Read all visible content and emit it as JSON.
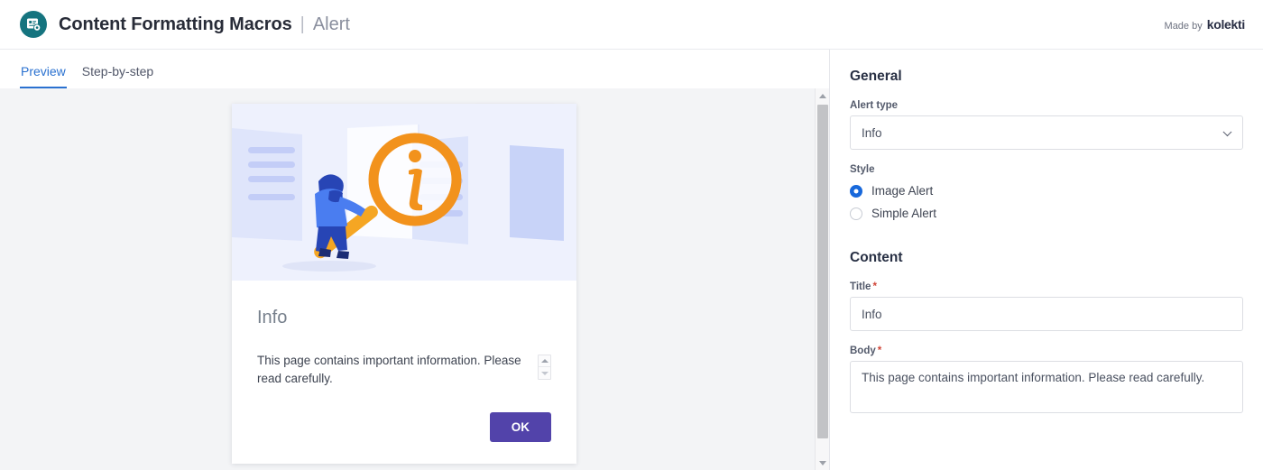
{
  "header": {
    "logo_icon": "document-gear-icon",
    "title": "Content Formatting Macros",
    "separator": "|",
    "subtitle": "Alert",
    "made_by_text": "Made by",
    "made_by_brand": "kolekti",
    "brand_color": "#15747f"
  },
  "tabs": [
    {
      "label": "Preview",
      "active": true
    },
    {
      "label": "Step-by-step",
      "active": false
    }
  ],
  "preview": {
    "theme_toggle": {
      "light_icon": "sun-icon",
      "dark_icon": "moon-icon",
      "active": "light"
    },
    "alert": {
      "illustration": "person-with-magnifying-glass-info-illustration",
      "title": "Info",
      "body": "This page contains important information. Please read carefully.",
      "stepper_up_icon": "arrow-up-icon",
      "stepper_down_icon": "arrow-down-icon",
      "ok_label": "OK",
      "ok_color": "#5243aa"
    },
    "scrollbar": {
      "up_icon": "scroll-up-arrow-icon",
      "down_icon": "scroll-down-arrow-icon"
    }
  },
  "settings": {
    "general_heading": "General",
    "alert_type_label": "Alert type",
    "alert_type_value": "Info",
    "alert_type_chevron": "chevron-down-icon",
    "style_label": "Style",
    "style_options": [
      {
        "label": "Image Alert",
        "selected": true
      },
      {
        "label": "Simple Alert",
        "selected": false
      }
    ],
    "content_heading": "Content",
    "title_label": "Title",
    "title_required": "*",
    "title_value": "Info",
    "body_label": "Body",
    "body_required": "*",
    "body_value": "This page contains important information. Please read carefully.",
    "accent_color": "#1868db"
  }
}
